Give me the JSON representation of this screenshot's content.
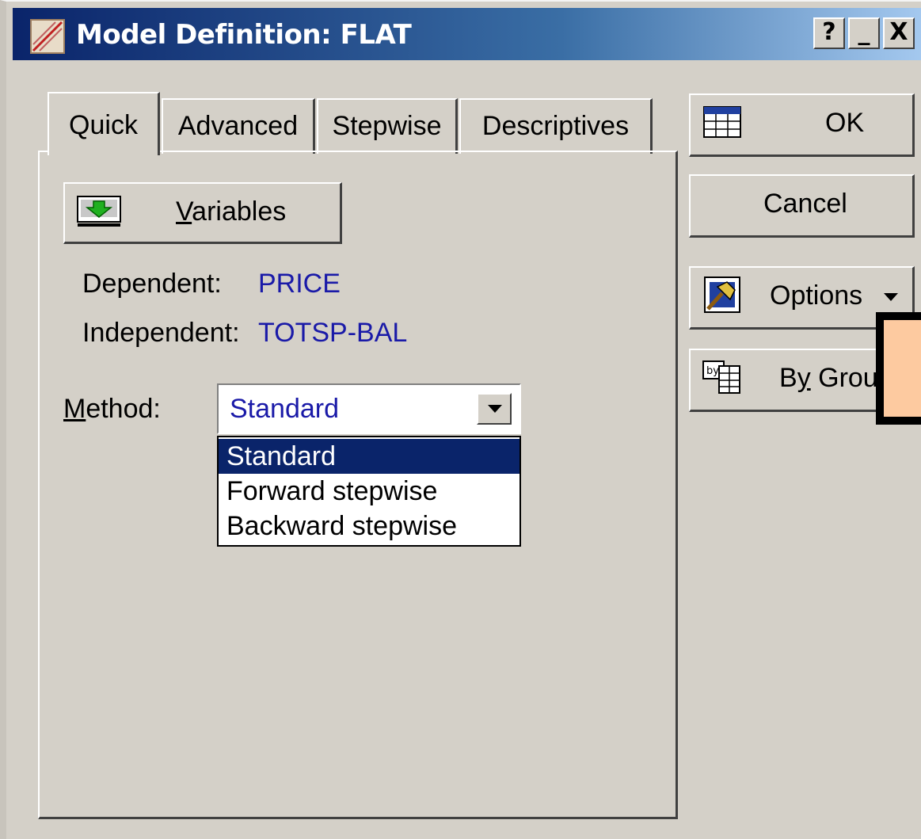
{
  "window": {
    "title": "Model Definition: FLAT",
    "title_icon": "model-definition-icon",
    "help_label": "?",
    "minimize_label": "_",
    "close_label": "X"
  },
  "tabs": [
    {
      "label": "Quick",
      "active": true
    },
    {
      "label": "Advanced",
      "active": false
    },
    {
      "label": "Stepwise",
      "active": false
    },
    {
      "label": "Descriptives",
      "active": false
    }
  ],
  "quick": {
    "variables_button": {
      "label": "Variables",
      "mnemonic": "V",
      "rest": "ariables",
      "icon": "variables-icon"
    },
    "dependent_label": "Dependent:",
    "dependent_value": "PRICE",
    "independent_label": "Independent:",
    "independent_value": "TOTSP-BAL",
    "method_label": "Method:",
    "method_mnemonic": "M",
    "method_rest": "ethod:",
    "method_selected": "Standard",
    "method_options": [
      "Standard",
      "Forward stepwise",
      "Backward stepwise"
    ]
  },
  "side_buttons": {
    "ok": {
      "label": "OK",
      "icon": "spreadsheet-icon"
    },
    "cancel": {
      "label": "Cancel"
    },
    "options": {
      "label": "Options",
      "icon": "hammer-icon",
      "arrow_icon": "dropdown-arrow-icon"
    },
    "by_group": {
      "label_pre": "B",
      "label_mnemonic": "y",
      "label_post": " Grou",
      "icon": "by-group-icon"
    }
  },
  "colors": {
    "title_gradient_start": "#0a246a",
    "face": "#d4d0c8",
    "value_text": "#1a1aa8",
    "selection": "#0a246a",
    "highlight_box": "#fdcaa0"
  }
}
